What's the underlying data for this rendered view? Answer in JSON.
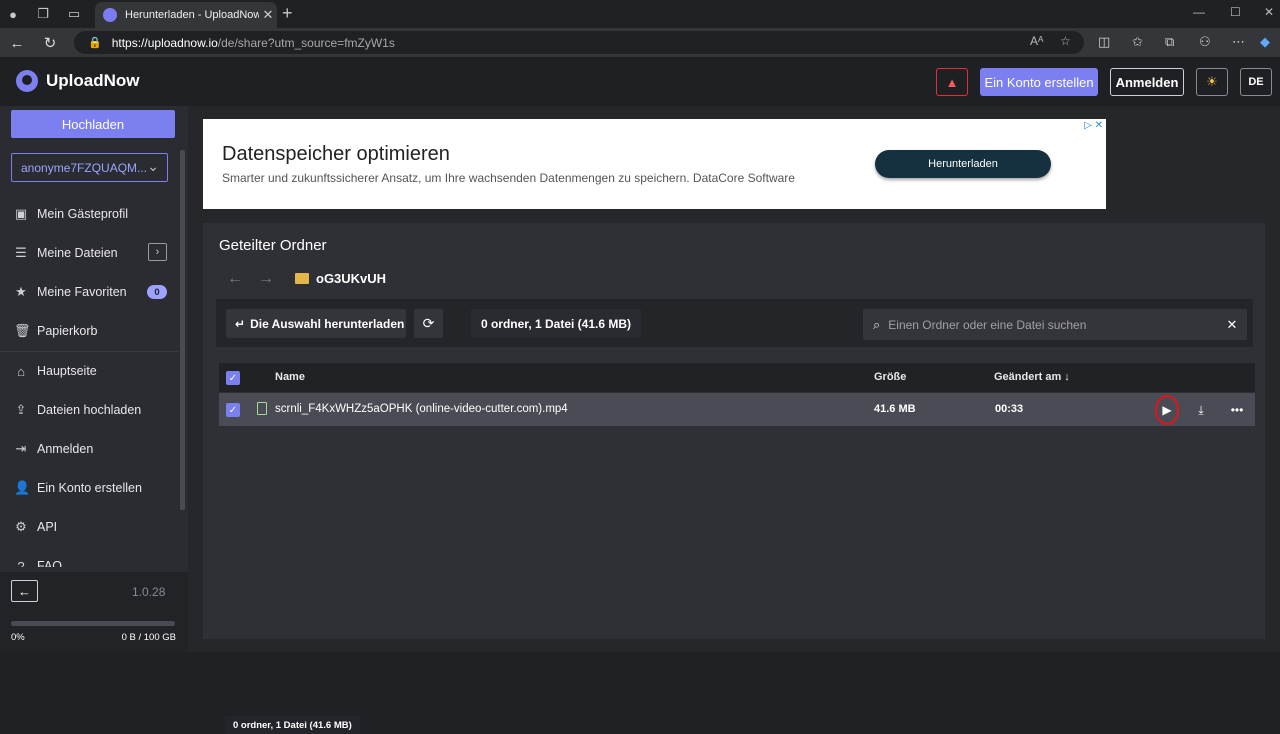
{
  "browser": {
    "tab_title": "Herunterladen - UploadNow.io",
    "url_host": "https://uploadnow.io",
    "url_path": "/de/share?utm_source=fmZyW1s"
  },
  "header": {
    "brand": "UploadNow",
    "signup_label": "Ein Konto erstellen",
    "login_label": "Anmelden",
    "lang_label": "DE"
  },
  "sidebar": {
    "upload_label": "Hochladen",
    "account_name": "anonyme7FZQUAQM...",
    "items": [
      {
        "label": "Mein Gästeprofil"
      },
      {
        "label": "Meine Dateien"
      },
      {
        "label": "Meine Favoriten",
        "badge": "0"
      },
      {
        "label": "Papierkorb"
      },
      {
        "label": "Hauptseite"
      },
      {
        "label": "Dateien hochladen"
      },
      {
        "label": "Anmelden"
      },
      {
        "label": "Ein Konto erstellen"
      },
      {
        "label": "API"
      },
      {
        "label": "FAQ"
      }
    ],
    "version": "1.0.28",
    "storage_percent": "0%",
    "storage_amount": "0 B / 100 GB"
  },
  "ad": {
    "title": "Datenspeicher optimieren",
    "subtitle": "Smarter und zukunftssicherer Ansatz, um Ihre wachsenden Datenmengen zu speichern. DataCore Software",
    "button_label": "Herunterladen"
  },
  "panel": {
    "title": "Geteilter Ordner",
    "folder_name": "oG3UKvUH",
    "download_selection_label": "Die Auswahl herunterladen",
    "count_label": "0 ordner, 1 Datei (41.6 MB)",
    "search_placeholder": "Einen Ordner oder eine Datei suchen",
    "columns": {
      "name": "Name",
      "size": "Größe",
      "modified": "Geändert am ↓"
    },
    "rows": [
      {
        "name": "scrnli_F4KxWHZz5aOPHK (online-video-cutter.com).mp4",
        "size": "41.6 MB",
        "modified": "00:33"
      }
    ],
    "footer_count": "0 ordner, 1 Datei (41.6 MB)"
  },
  "colors": {
    "accent": "#7b7ff0",
    "highlight_ring": "#e3131d",
    "folder": "#e6b54a"
  }
}
